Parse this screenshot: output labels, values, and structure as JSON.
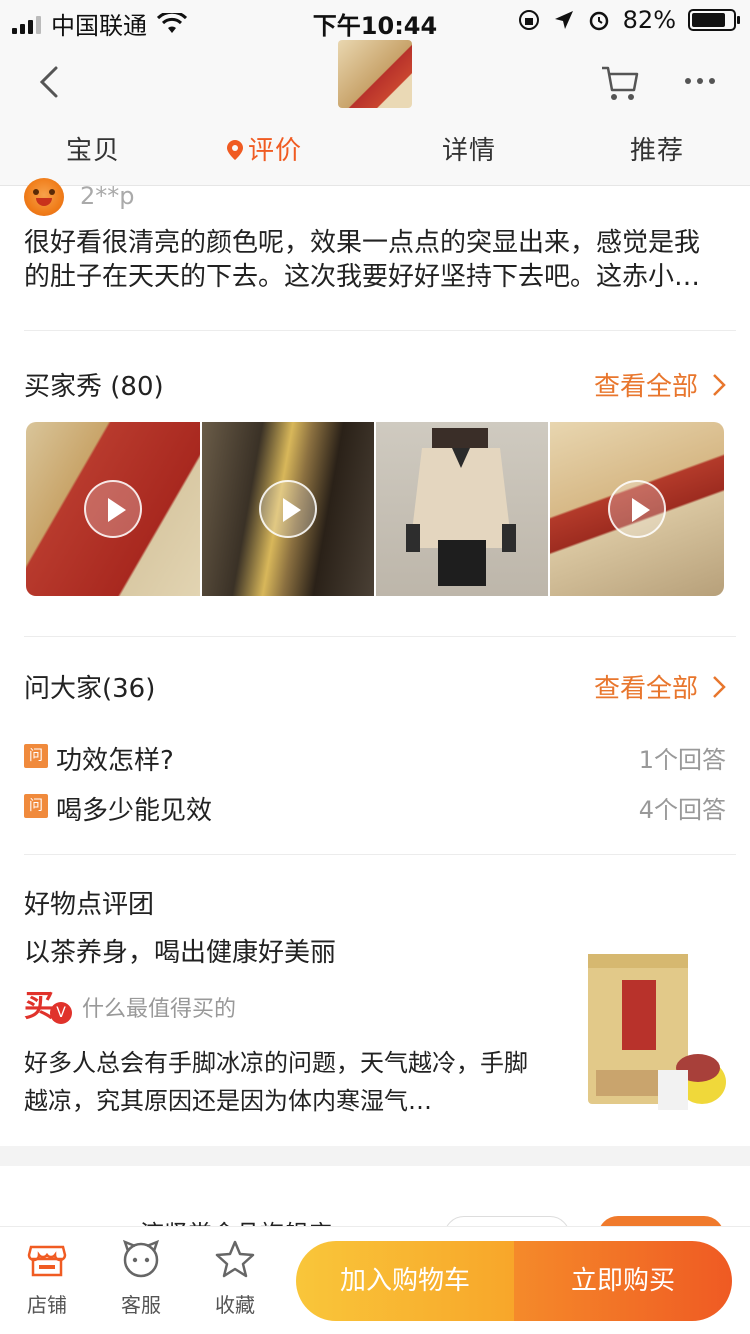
{
  "status_bar": {
    "carrier": "中国联通",
    "time": "下午10:44",
    "battery": "82%",
    "battery_level": 0.82
  },
  "header": {
    "tabs": [
      {
        "label": "宝贝"
      },
      {
        "label": "评价"
      },
      {
        "label": "详情"
      },
      {
        "label": "推荐"
      }
    ],
    "active_tab": "评价"
  },
  "review": {
    "user": "2**p",
    "text": "很好看很清亮的颜色呢，效果一点点的突显出来，感觉是我的肚子在天天的下去。这次我要好好坚持下去吧。这赤小…"
  },
  "buyer_show": {
    "title": "买家秀 (80)",
    "see_all": "查看全部"
  },
  "ask": {
    "title": "问大家(36)",
    "see_all": "查看全部",
    "badge": "问",
    "questions": [
      {
        "q": "功效怎样?",
        "answers": "1个回答"
      },
      {
        "q": "喝多少能见效",
        "answers": "4个回答"
      }
    ]
  },
  "haowu": {
    "title": "好物点评团",
    "subtitle": "以茶养身，喝出健康好美丽",
    "logo_char": "买",
    "logo_badge": "V",
    "author": "什么最值得买的",
    "desc": "好多人总会有手脚冰凉的问题，天气越冷，手脚越凉，究其原因还是因为体内寒湿气…"
  },
  "store_peek": {
    "name": "济贤堂食品旗舰店"
  },
  "bottom_bar": {
    "shop": "店铺",
    "service": "客服",
    "favorite": "收藏",
    "add_to_cart": "加入购物车",
    "buy_now": "立即购买"
  },
  "colors": {
    "accent": "#f05b22",
    "see_all": "#e8762d",
    "cart_button": "#f9c63a",
    "buy_button": "#ef5a23"
  }
}
